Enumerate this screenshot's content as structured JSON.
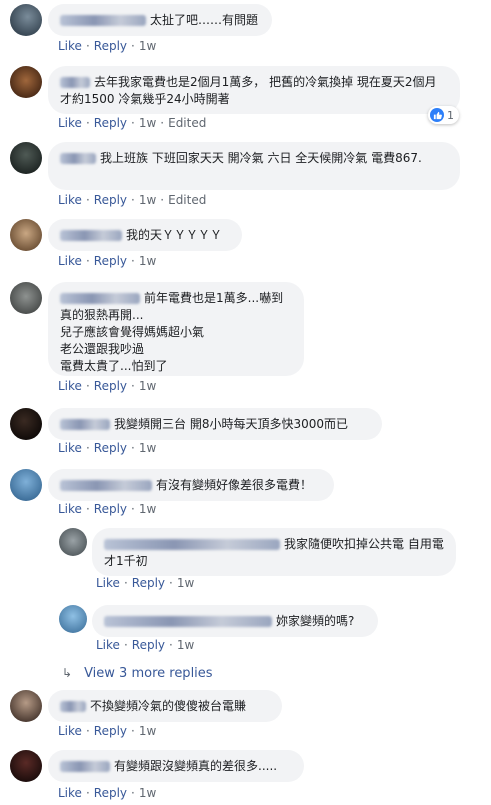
{
  "comments": [
    {
      "text": "太扯了吧……有問題",
      "actions": {
        "like": "Like",
        "reply": "Reply",
        "time": "1w"
      }
    },
    {
      "text": "去年我家電費也是2個月1萬多， 把舊的冷氣換掉 現在夏天2個月才約1500 冷氣幾乎24小時開著",
      "actions": {
        "like": "Like",
        "reply": "Reply",
        "time": "1w",
        "edited": "Edited"
      },
      "reaction_count": "1"
    },
    {
      "text": "我上班族 下班回家天天 開冷氣 六日 全天候開冷氣 電費867.",
      "actions": {
        "like": "Like",
        "reply": "Reply",
        "time": "1w",
        "edited": "Edited"
      }
    },
    {
      "text": "我的天ＹＹＹＹＹ",
      "actions": {
        "like": "Like",
        "reply": "Reply",
        "time": "1w"
      }
    },
    {
      "text_lines": [
        "前年電費也是1萬多...嚇到",
        "真的狠熱再開...",
        "兒子應該會覺得媽媽超小氣",
        "老公還跟我吵過",
        "電費太貴了...怕到了"
      ],
      "actions": {
        "like": "Like",
        "reply": "Reply",
        "time": "1w"
      }
    },
    {
      "text": "我變頻開三台 開8小時每天頂多快3000而已",
      "actions": {
        "like": "Like",
        "reply": "Reply",
        "time": "1w"
      }
    },
    {
      "text": "有沒有變頻好像差很多電費！",
      "actions": {
        "like": "Like",
        "reply": "Reply",
        "time": "1w"
      }
    },
    {
      "text": "我家隨便吹扣掉公共電 自用電才1千初",
      "actions": {
        "like": "Like",
        "reply": "Reply",
        "time": "1w"
      }
    },
    {
      "text": "妳家變頻的嗎?",
      "actions": {
        "like": "Like",
        "reply": "Reply",
        "time": "1w"
      }
    },
    {
      "text": "不換變頻冷氣的傻傻被台電賺",
      "actions": {
        "like": "Like",
        "reply": "Reply",
        "time": "1w"
      }
    },
    {
      "text": "有變頻跟沒變頻真的差很多.....",
      "actions": {
        "like": "Like",
        "reply": "Reply",
        "time": "1w"
      }
    }
  ],
  "view_more_replies": "View 3 more replies",
  "colors": {
    "link": "#385898",
    "bubble": "#f2f3f5",
    "meta": "#606770",
    "like_blue": "#2d7ff9"
  }
}
